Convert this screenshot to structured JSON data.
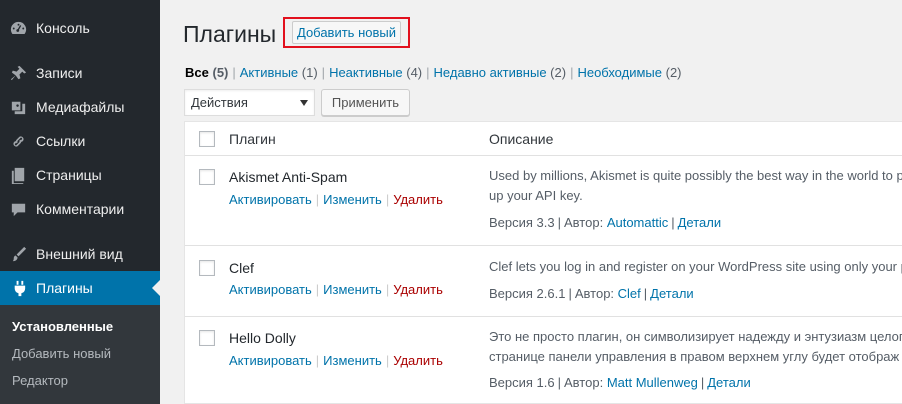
{
  "sidebar": {
    "items": [
      {
        "label": "Консоль",
        "icon": "dashboard-icon"
      },
      {
        "label": "Записи",
        "icon": "pin-icon"
      },
      {
        "label": "Медиафайлы",
        "icon": "media-icon"
      },
      {
        "label": "Ссылки",
        "icon": "link-icon"
      },
      {
        "label": "Страницы",
        "icon": "pages-icon"
      },
      {
        "label": "Комментарии",
        "icon": "comment-icon"
      },
      {
        "label": "Внешний вид",
        "icon": "brush-icon"
      },
      {
        "label": "Плагины",
        "icon": "plugin-icon"
      }
    ],
    "submenu": [
      "Установленные",
      "Добавить новый",
      "Редактор"
    ],
    "active_color": "#0073aa"
  },
  "header": {
    "title": "Плагины",
    "add_new": "Добавить новый",
    "highlight_color": "#e2101d"
  },
  "filters": [
    {
      "label": "Все",
      "count": "(5)"
    },
    {
      "label": "Активные",
      "count": "(1)"
    },
    {
      "label": "Неактивные",
      "count": "(4)"
    },
    {
      "label": "Недавно активные",
      "count": "(2)"
    },
    {
      "label": "Необходимые",
      "count": "(2)"
    }
  ],
  "bulk": {
    "select": "Действия",
    "apply": "Применить"
  },
  "table": {
    "columns": {
      "plugin": "Плагин",
      "description": "Описание"
    },
    "plugins": [
      {
        "name": "Akismet Anti-Spam",
        "actions": [
          "Активировать",
          "Изменить",
          "Удалить"
        ],
        "desc1": "Used by millions, Akismet is quite possibly the best way in the world to p",
        "desc2": "up your API key.",
        "version": "Версия 3.3",
        "author_prefix": "Автор:",
        "author": "Automattic",
        "details": "Детали"
      },
      {
        "name": "Clef",
        "actions": [
          "Активировать",
          "Изменить",
          "Удалить"
        ],
        "desc1": "Clef lets you log in and register on your WordPress site using only your p",
        "desc2": "",
        "version": "Версия 2.6.1",
        "author_prefix": "Автор:",
        "author": "Clef",
        "details": "Детали"
      },
      {
        "name": "Hello Dolly",
        "actions": [
          "Активировать",
          "Изменить",
          "Удалить"
        ],
        "desc1": "Это не просто плагин, он символизирует надежду и энтузиазм целого",
        "desc2": "странице панели управления в правом верхнем углу будет отображ",
        "version": "Версия 1.6",
        "author_prefix": "Автор:",
        "author": "Matt Mullenweg",
        "details": "Детали"
      }
    ]
  }
}
